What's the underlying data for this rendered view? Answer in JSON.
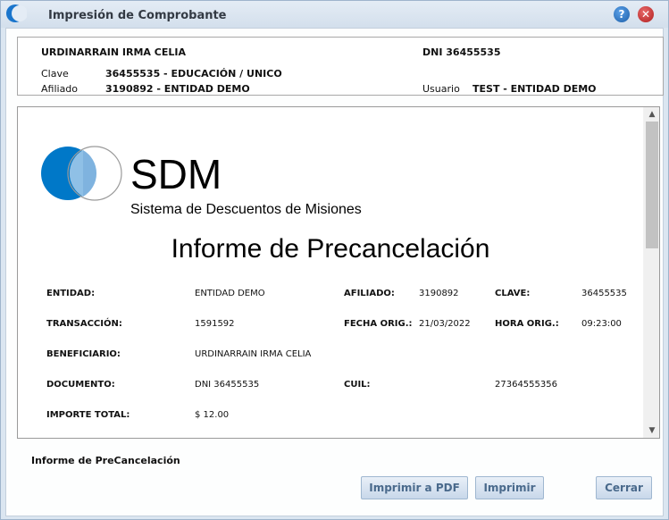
{
  "window": {
    "title": "Impresión de Comprobante"
  },
  "header": {
    "name": "URDINARRAIN IRMA CELIA",
    "dni": "DNI  36455535",
    "clave_label": "Clave",
    "clave_value": "36455535  -  EDUCACIÓN / UNICO",
    "afiliado_label": "Afiliado",
    "afiliado_value": "3190892  -  ENTIDAD DEMO",
    "usuario_label": "Usuario",
    "usuario_value": "TEST  -  ENTIDAD DEMO"
  },
  "document": {
    "logo_text": "SDM",
    "logo_subtitle": "Sistema de Descuentos de Misiones",
    "title": "Informe de Precancelación",
    "fields": {
      "entidad_label": "ENTIDAD:",
      "entidad_value": "ENTIDAD DEMO",
      "afiliado_label": "AFILIADO:",
      "afiliado_value": "3190892",
      "clave_label": "CLAVE:",
      "clave_value": "36455535",
      "transaccion_label": "TRANSACCIÓN:",
      "transaccion_value": "1591592",
      "fecha_label": "FECHA ORIG.:",
      "fecha_value": "21/03/2022",
      "hora_label": "HORA ORIG.:",
      "hora_value": "09:23:00",
      "beneficiario_label": "BENEFICIARIO:",
      "beneficiario_value": "URDINARRAIN IRMA CELIA",
      "documento_label": "DOCUMENTO:",
      "documento_value": "DNI 36455535",
      "cuil_label": "CUIL:",
      "cuil_value": "27364555356",
      "importe_label": "IMPORTE TOTAL:",
      "importe_value": "$  12.00"
    }
  },
  "footer": {
    "label": "Informe de PreCancelación",
    "pdf_button": "Imprimir a PDF",
    "print_button": "Imprimir",
    "close_button": "Cerrar"
  },
  "icons": {
    "help": "help-icon",
    "close": "close-icon",
    "app": "app-logo-icon"
  },
  "colors": {
    "accent_blue": "#0078c8",
    "titlebar": "#d3dfec",
    "button_text": "#4a6a8c"
  }
}
